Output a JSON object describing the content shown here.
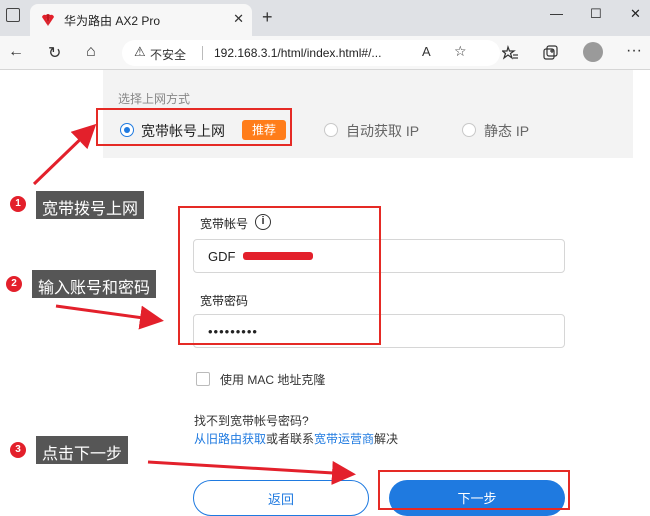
{
  "browser": {
    "tab_title": "华为路由 AX2 Pro",
    "tab_close": "✕",
    "new_tab": "+",
    "window_controls": [
      "—",
      "☐",
      "✕"
    ],
    "nav": {
      "back": "←",
      "reload": "↻",
      "home": "⌂"
    },
    "security_icon": "⚠",
    "security_label": "不安全",
    "url": "192.168.3.1/html/index.html#/...",
    "read_aloud_icon": "A",
    "favorite_icon": "☆",
    "toolbar_icons": [
      "collections-icon",
      "extensions-icon",
      "avatar-icon",
      "more-icon"
    ],
    "more_icon": "···",
    "colors": {
      "tabbar": "#dfe1e5",
      "toolbar": "#f7f7f7"
    }
  },
  "page": {
    "section_title": "选择上网方式",
    "options": [
      {
        "label": "宽带帐号上网",
        "selected": true
      },
      {
        "label": "自动获取 IP",
        "selected": false
      },
      {
        "label": "静态 IP",
        "selected": false
      }
    ],
    "recommend_badge": "推荐",
    "account_label": "宽带帐号",
    "info_icon": "i",
    "account_value": "GDF",
    "password_label": "宽带密码",
    "password_value": "•••••••••",
    "mac_clone_label": "使用 MAC 地址克隆",
    "mac_clone_checked": false,
    "help_line1": "找不到宽带帐号密码?",
    "help_link1": "从旧路由获取",
    "help_middle": "或者联系",
    "help_link2": "宽带运营商",
    "help_end": "解决",
    "back_button": "返回",
    "next_button": "下一步",
    "colors": {
      "accent": "#1f7ae0",
      "badge": "#ff7d1a",
      "highlight": "#e52a25",
      "annotation": "#565656"
    }
  },
  "annotations": [
    {
      "number": "1",
      "text": "宽带拨号上网"
    },
    {
      "number": "2",
      "text": "输入账号和密码"
    },
    {
      "number": "3",
      "text": "点击下一步"
    }
  ]
}
